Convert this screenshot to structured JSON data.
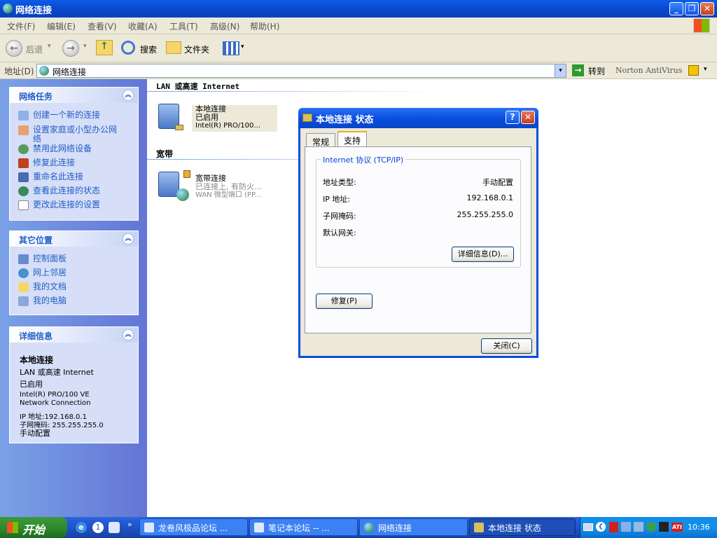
{
  "window": {
    "title": "网络连接"
  },
  "menu": [
    "文件(F)",
    "编辑(E)",
    "查看(V)",
    "收藏(A)",
    "工具(T)",
    "高级(N)",
    "帮助(H)"
  ],
  "toolbar": {
    "back": "后退",
    "search": "搜索",
    "folders": "文件夹"
  },
  "addressbar": {
    "label": "地址(D)",
    "value": "网络连接",
    "go": "转到",
    "norton": "Norton AntiVirus"
  },
  "sidebar": {
    "tasks": {
      "title": "网络任务",
      "items": [
        "创建一个新的连接",
        "设置家庭或小型办公网络",
        "禁用此网络设备",
        "修复此连接",
        "重命名此连接",
        "查看此连接的状态",
        "更改此连接的设置"
      ]
    },
    "places": {
      "title": "其它位置",
      "items": [
        "控制面板",
        "网上邻居",
        "我的文档",
        "我的电脑"
      ]
    },
    "details": {
      "title": "详细信息",
      "name": "本地连接",
      "type": "LAN 或高速 Internet",
      "status": "已启用",
      "device1": "Intel(R) PRO/100 VE",
      "device2": "Network Connection",
      "ip": "IP 地址:192.168.0.1",
      "mask": "子网掩码: 255.255.255.0",
      "config": "手动配置"
    }
  },
  "content": {
    "group_lan": "LAN 或高速 Internet",
    "lan": {
      "name": "本地连接",
      "status": "已启用",
      "device": "Intel(R) PRO/100..."
    },
    "group_broadband": "宽带",
    "broadband": {
      "name": "宽带连接",
      "status": "已连接上, 有防火...",
      "device": "WAN 微型端口 (PP..."
    }
  },
  "dialog": {
    "title": "本地连接 状态",
    "tabs": [
      "常规",
      "支持"
    ],
    "group": "Internet 协议 (TCP/IP)",
    "rows": [
      {
        "label": "地址类型:",
        "value": "手动配置"
      },
      {
        "label": "IP 地址:",
        "value": "192.168.0.1"
      },
      {
        "label": "子网掩码:",
        "value": "255.255.255.0"
      },
      {
        "label": "默认网关:",
        "value": ""
      }
    ],
    "details_btn": "详细信息(D)...",
    "repair_btn": "修复(P)",
    "close_btn": "关闭(C)"
  },
  "taskbar": {
    "start": "开始",
    "items": [
      "龙卷风极品论坛 ...",
      "笔记本论坛 -- ...",
      "网络连接",
      "本地连接 状态"
    ],
    "clock": "10:36"
  }
}
